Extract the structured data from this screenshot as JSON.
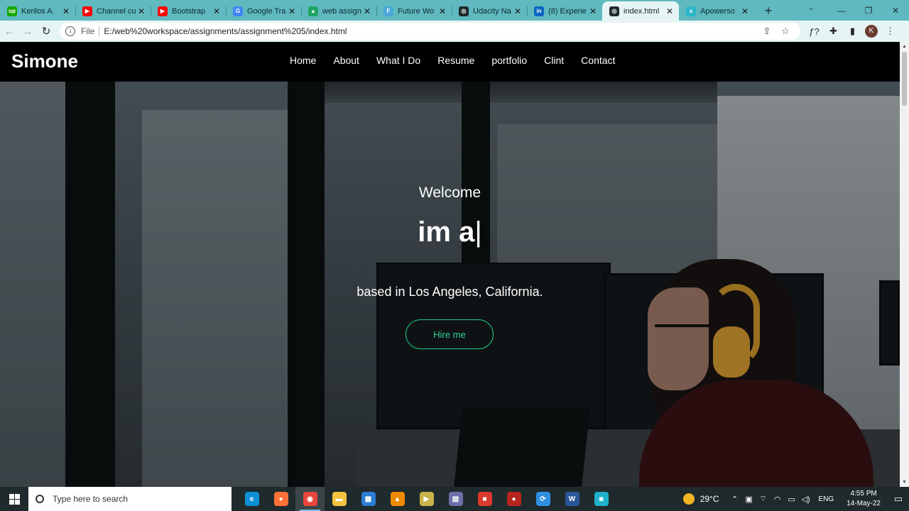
{
  "browser": {
    "tabs": [
      {
        "title": "Kerilos A.",
        "icon": "upwork-icon",
        "color": "#14a800",
        "glyph": "up"
      },
      {
        "title": "Channel cu",
        "icon": "youtube-icon",
        "color": "#ff0000",
        "glyph": "▶"
      },
      {
        "title": "Bootstrap",
        "icon": "youtube-icon",
        "color": "#ff0000",
        "glyph": "▶"
      },
      {
        "title": "Google Tra",
        "icon": "google-translate-icon",
        "color": "#4285f4",
        "glyph": "G"
      },
      {
        "title": "web assign",
        "icon": "google-drive-icon",
        "color": "#1fa463",
        "glyph": "▲"
      },
      {
        "title": "Future Wo",
        "icon": "future-icon",
        "color": "#4aa7d8",
        "glyph": "F"
      },
      {
        "title": "Udacity Na",
        "icon": "globe-icon",
        "color": "#1f2a2c",
        "glyph": "◎"
      },
      {
        "title": "(8) Experie",
        "icon": "linkedin-icon",
        "color": "#0a66c2",
        "glyph": "in"
      },
      {
        "title": "index.html",
        "icon": "globe-icon",
        "color": "#1f2a2c",
        "glyph": "◎",
        "active": true
      },
      {
        "title": "Apowerso",
        "icon": "apowersoft-icon",
        "color": "#2bb5c9",
        "glyph": "a"
      }
    ],
    "url_scheme_label": "File",
    "url": "E:/web%20workspace/assignments/assignment%205/index.html",
    "profile_initial": "K"
  },
  "site": {
    "brand": "Simone",
    "menu": [
      "Home",
      "About",
      "What I Do",
      "Resume",
      "portfolio",
      "Clint",
      "Contact"
    ],
    "hero": {
      "welcome": "Welcome",
      "typed_text": "im a",
      "cursor": "|",
      "location": "based in Los Angeles, California.",
      "cta": "Hire me"
    }
  },
  "taskbar": {
    "search_placeholder": "Type here to search",
    "apps": [
      {
        "name": "edge-icon",
        "color": "#0c8fd6",
        "glyph": "e"
      },
      {
        "name": "firefox-icon",
        "color": "#ff7139",
        "glyph": "●"
      },
      {
        "name": "chrome-icon",
        "color": "#e8453c",
        "glyph": "◉",
        "active": true
      },
      {
        "name": "file-explorer-icon",
        "color": "#f2c33d",
        "glyph": "▬"
      },
      {
        "name": "store-icon",
        "color": "#2b7cd3",
        "glyph": "▦"
      },
      {
        "name": "vlc-icon",
        "color": "#f08a00",
        "glyph": "▲"
      },
      {
        "name": "media-icon",
        "color": "#c8b24a",
        "glyph": "▶"
      },
      {
        "name": "calculator-icon",
        "color": "#6d6fa8",
        "glyph": "▤"
      },
      {
        "name": "multi-app-icon",
        "color": "#d93a2b",
        "glyph": "■"
      },
      {
        "name": "red-app-icon",
        "color": "#b8251d",
        "glyph": "●"
      },
      {
        "name": "sync-icon",
        "color": "#2f8fe0",
        "glyph": "⟳"
      },
      {
        "name": "word-icon",
        "color": "#2b579a",
        "glyph": "W"
      },
      {
        "name": "camera-app-icon",
        "color": "#1fb1c9",
        "glyph": "◙"
      }
    ],
    "weather": "29°C",
    "language": "ENG",
    "time": "4:55 PM",
    "date": "14-May-22"
  }
}
